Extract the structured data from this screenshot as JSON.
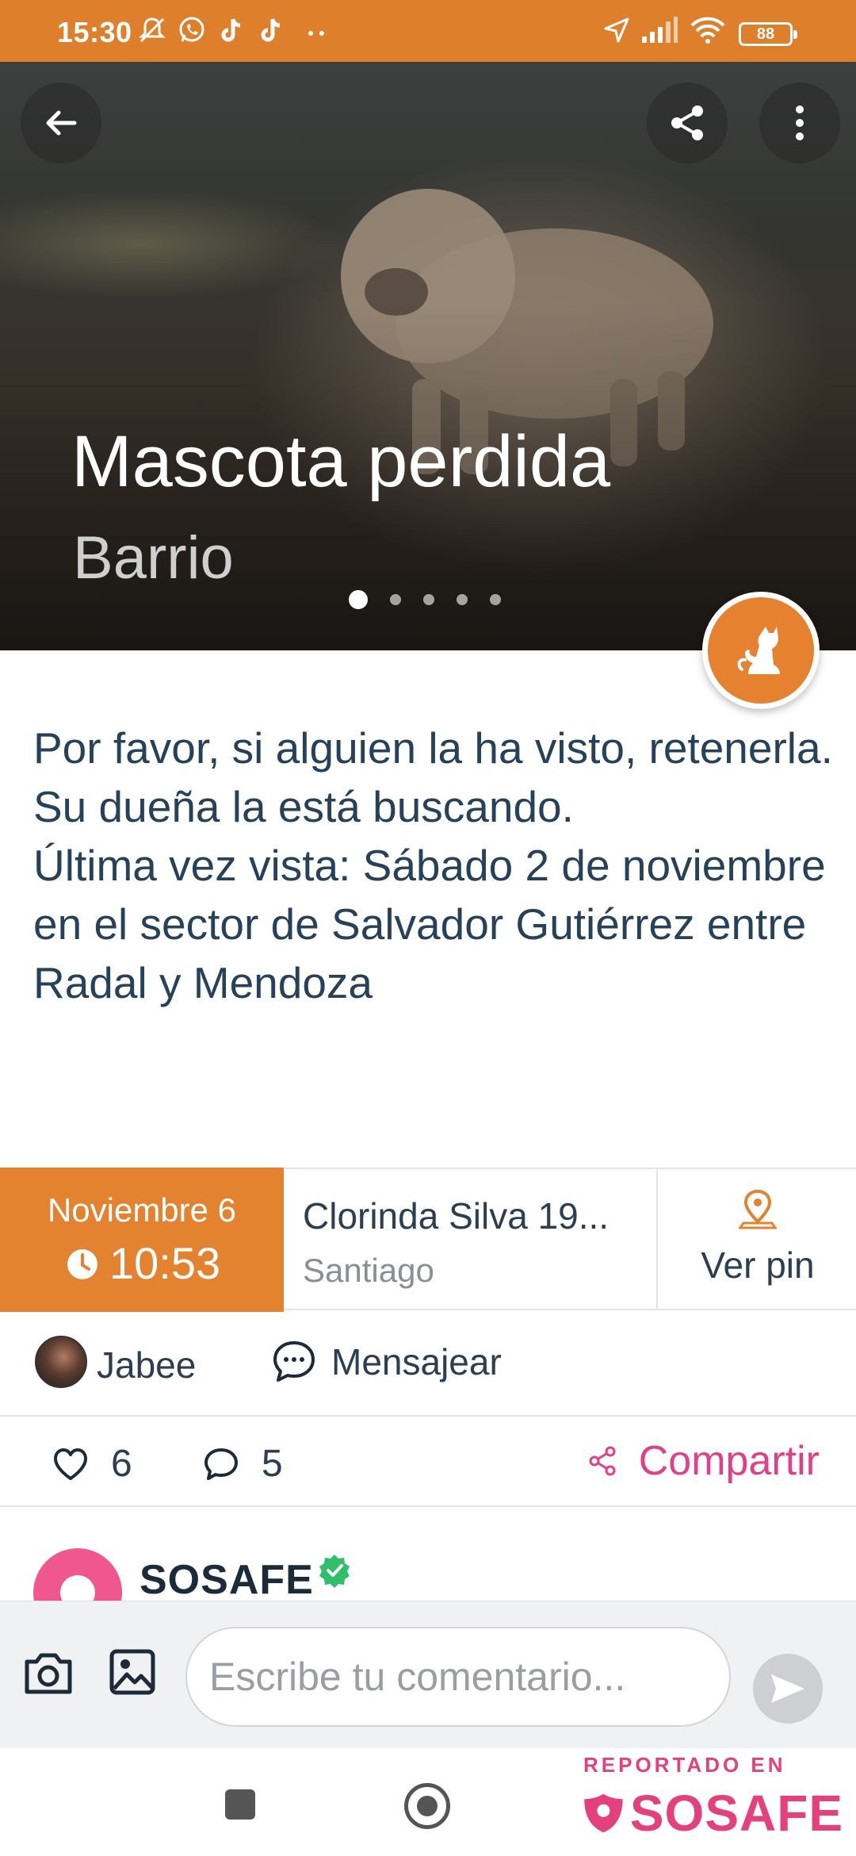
{
  "status_bar": {
    "time": "15:30",
    "battery": "88",
    "icons": [
      "mute-icon",
      "whatsapp-icon",
      "tiktok-icon",
      "tiktok-icon",
      "more-dots-icon",
      "location-arrow-icon",
      "signal-icon",
      "wifi-icon"
    ]
  },
  "hero": {
    "title": "Mascota perdida",
    "subtitle": "Barrio",
    "image_pages": 5,
    "active_page": 1
  },
  "description": "Por favor, si alguien la ha visto, retenerla.\nSu dueña la está buscando.\nÚltima vez vista: Sábado 2 de noviembre en el sector de Salvador Gutiérrez entre Radal y Mendoza",
  "info": {
    "date": "Noviembre 6",
    "time": "10:53",
    "street": "Clorinda Silva  19...",
    "city": "Santiago",
    "pin_label": "Ver pin"
  },
  "user": {
    "name": "Jabee",
    "message_label": "Mensajear"
  },
  "reactions": {
    "likes": "6",
    "comments": "5",
    "share_label": "Compartir"
  },
  "author": {
    "name": "SOSAFE"
  },
  "comment": {
    "placeholder": "Escribe tu comentario..."
  },
  "watermark": {
    "top": "REPORTADO EN",
    "brand": "SOSAFE"
  },
  "colors": {
    "brand_orange": "#de7f2b",
    "accent_pink": "#e33f86",
    "text_dark": "#26415a"
  }
}
